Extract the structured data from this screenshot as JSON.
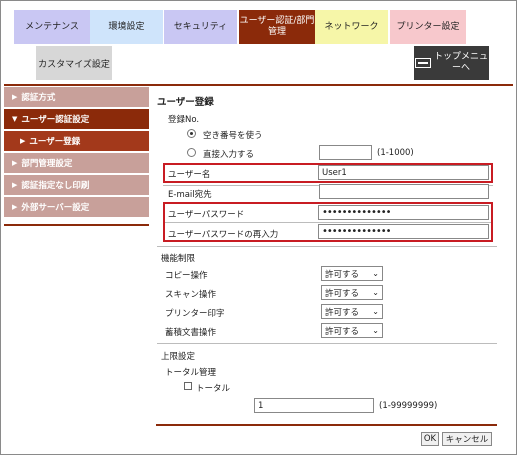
{
  "tabs": [
    {
      "label": "メンテナンス",
      "bg": "#c9c7f3"
    },
    {
      "label": "環境設定",
      "bg": "#cfe4fb"
    },
    {
      "label": "セキュリティ",
      "bg": "#c9c7f3"
    },
    {
      "label": "ユーザー認証/部門\n管理",
      "bg": "#8b2a0a"
    },
    {
      "label": "ネットワーク",
      "bg": "#f6f6a8"
    },
    {
      "label": "プリンター設定",
      "bg": "#f7c8cc"
    }
  ],
  "tab_customize": "カスタマイズ設定",
  "top_menu": "トップメニュ\nーへ",
  "sidebar": {
    "auth_method": "認証方式",
    "user_auth_settings": "ユーザー認証設定",
    "user_registration": "ユーザー登録",
    "dept_settings": "部門管理設定",
    "no_auth_print": "認証指定なし印刷",
    "external_server": "外部サーバー設定"
  },
  "form": {
    "title": "ユーザー登録",
    "reg_no_label": "登録No.",
    "opt_free": "空き番号を使う",
    "opt_direct": "直接入力する",
    "direct_value": "",
    "direct_range": "(1-1000)",
    "username_label": "ユーザー名",
    "username_value": "User1",
    "email_label": "E-mail宛先",
    "email_value": "",
    "password_label": "ユーザーパスワード",
    "password_value": "••••••••••••••",
    "password_re_label": "ユーザーパスワードの再入力",
    "password_re_value": "••••••••••••••",
    "func_title": "機能制限",
    "copy_label": "コピー操作",
    "scan_label": "スキャン操作",
    "print_label": "プリンター印字",
    "box_label": "蓄積文書操作",
    "copy_value": "許可する",
    "scan_value": "許可する",
    "print_value": "許可する",
    "box_value": "許可する",
    "limit_title": "上限設定",
    "total_mgmt": "トータル管理",
    "total_check": "トータル",
    "total_value": "1",
    "total_range": "(1-99999999)",
    "ok": "OK",
    "cancel": "キャンセル"
  },
  "colors": {
    "accent": "#8b2a0a",
    "highlight": "#c81c23"
  }
}
